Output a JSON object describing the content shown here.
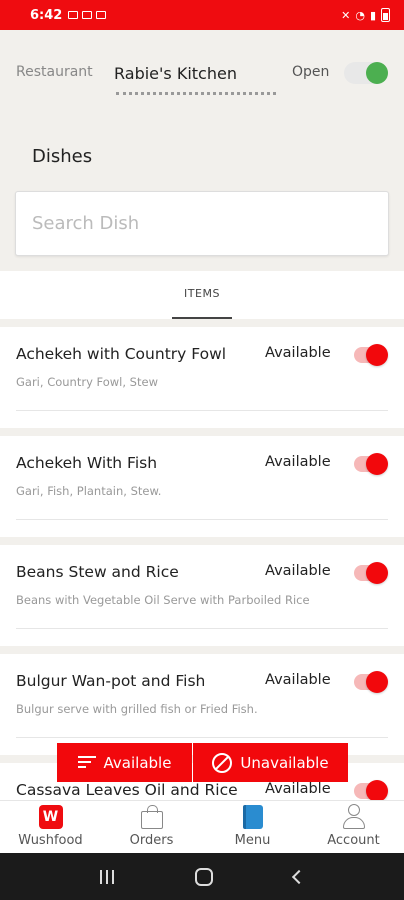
{
  "status_bar": {
    "time": "6:42"
  },
  "header": {
    "restaurant_label": "Restaurant",
    "restaurant_name": "Rabie's Kitchen",
    "open_label": "Open",
    "open_state": true
  },
  "dishes_title": "Dishes",
  "search": {
    "placeholder": "Search Dish",
    "value": ""
  },
  "tabs": [
    {
      "label": "ITEMS",
      "active": true
    }
  ],
  "dishes": [
    {
      "name": "Achekeh with Country Fowl",
      "description": "Gari, Country Fowl, Stew",
      "status_label": "Available",
      "available": true
    },
    {
      "name": "Achekeh With Fish",
      "description": "Gari, Fish, Plantain, Stew.",
      "status_label": "Available",
      "available": true
    },
    {
      "name": "Beans Stew and Rice",
      "description": "Beans with Vegetable Oil Serve with Parboiled Rice",
      "status_label": "Available",
      "available": true
    },
    {
      "name": "Bulgur Wan-pot and Fish",
      "description": "Bulgur serve with grilled fish or Fried Fish.",
      "status_label": "Available",
      "available": true
    },
    {
      "name": "Cassava Leaves Oil and Rice",
      "description": "",
      "status_label": "Available",
      "available": true
    }
  ],
  "filter_bar": {
    "available_label": "Available",
    "unavailable_label": "Unavailable"
  },
  "bottom_nav": [
    {
      "label": "Wushfood",
      "icon": "wushfood-logo-icon"
    },
    {
      "label": "Orders",
      "icon": "shopping-bag-icon"
    },
    {
      "label": "Menu",
      "icon": "menu-book-icon"
    },
    {
      "label": "Account",
      "icon": "account-icon"
    }
  ],
  "colors": {
    "accent": "#ef0c10",
    "open_green": "#4caf50",
    "menu_blue": "#2a8cd0"
  }
}
